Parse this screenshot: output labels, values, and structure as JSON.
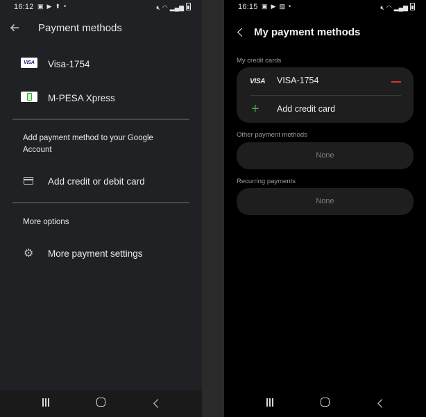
{
  "left": {
    "status": {
      "time": "16:12"
    },
    "header": {
      "title": "Payment methods"
    },
    "methods": [
      {
        "label": "Visa-1754",
        "icon": "visa-card-icon",
        "badge": "VISA"
      },
      {
        "label": "M-PESA Xpress",
        "icon": "mpesa-icon"
      }
    ],
    "add_section": {
      "text": "Add payment method to your Google Account",
      "add_card_label": "Add credit or debit card"
    },
    "more": {
      "heading": "More options",
      "settings_label": "More payment settings"
    }
  },
  "right": {
    "status": {
      "time": "16:15"
    },
    "header": {
      "title": "My payment methods"
    },
    "credit_cards": {
      "heading": "My credit cards",
      "card_brand": "VISA",
      "card_label": "VISA-1754",
      "add_label": "Add credit card"
    },
    "other": {
      "heading": "Other payment methods",
      "value": "None"
    },
    "recurring": {
      "heading": "Recurring payments",
      "value": "None"
    }
  },
  "colors": {
    "left_bg": "#202124",
    "right_bg": "#000000",
    "remove_red": "#d9342b",
    "add_green": "#3ea856"
  }
}
